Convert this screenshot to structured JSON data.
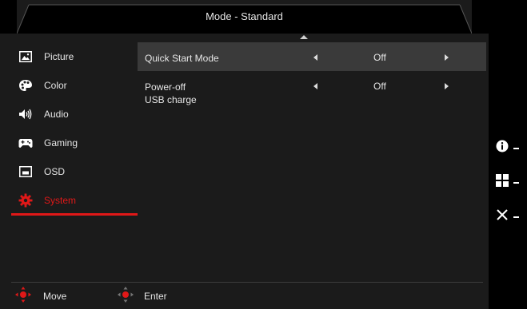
{
  "header": {
    "title": "Mode - Standard"
  },
  "sidebar": {
    "items": [
      {
        "label": "Picture",
        "icon": "picture-icon"
      },
      {
        "label": "Color",
        "icon": "palette-icon"
      },
      {
        "label": "Audio",
        "icon": "speaker-icon"
      },
      {
        "label": "Gaming",
        "icon": "gamepad-icon"
      },
      {
        "label": "OSD",
        "icon": "osd-icon"
      },
      {
        "label": "System",
        "icon": "gear-icon",
        "active": true
      }
    ]
  },
  "settings": [
    {
      "name": "Quick Start Mode",
      "value": "Off",
      "highlighted": true
    },
    {
      "name_line1": "Power-off",
      "name_line2": "USB charge",
      "value": "Off"
    }
  ],
  "footer": {
    "move_label": "Move",
    "enter_label": "Enter"
  },
  "right_bar": {
    "icons": [
      "info-icon",
      "menu-grid-icon",
      "close-icon"
    ]
  },
  "colors": {
    "accent": "#e01818",
    "panel": "#1b1b1b",
    "highlight": "#3a3a3a"
  }
}
